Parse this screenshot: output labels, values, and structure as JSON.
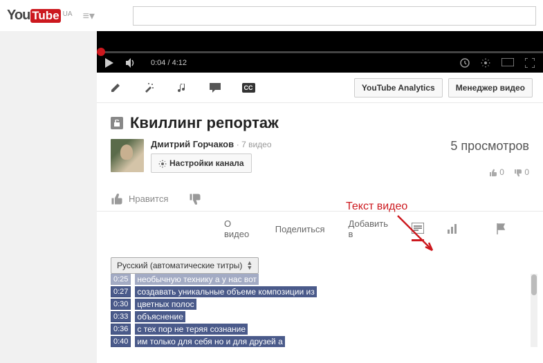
{
  "header": {
    "logo_you": "You",
    "logo_tube": "Tube",
    "locale": "UA",
    "search_placeholder": ""
  },
  "player": {
    "current_time": "0:04",
    "duration": "4:12"
  },
  "toolbar": {
    "cc_label": "CC",
    "analytics_btn": "YouTube Analytics",
    "manager_btn": "Менеджер видео"
  },
  "video": {
    "title": "Квиллинг репортаж"
  },
  "channel": {
    "name": "Дмитрий Горчаков",
    "video_count": "7 видео",
    "settings_btn": "Настройки канала"
  },
  "stats": {
    "views": "5 просмотров",
    "likes": "0",
    "dislikes": "0"
  },
  "actions": {
    "like_label": "Нравится"
  },
  "annotation": "Текст видео",
  "tabs": {
    "about": "О видео",
    "share": "Поделиться",
    "add_to": "Добавить в"
  },
  "transcript": {
    "language": "Русский (автоматические титры)",
    "lines": [
      {
        "time": "0:25",
        "text": "необычную технику а у нас вот"
      },
      {
        "time": "0:27",
        "text": "создавать уникальные объеме композиции из"
      },
      {
        "time": "0:30",
        "text": "цветных полос"
      },
      {
        "time": "0:33",
        "text": "объяснение"
      },
      {
        "time": "0:36",
        "text": "с тех пор не теряя сознание"
      },
      {
        "time": "0:40",
        "text": "им только для себя но и для друзей а"
      }
    ]
  }
}
